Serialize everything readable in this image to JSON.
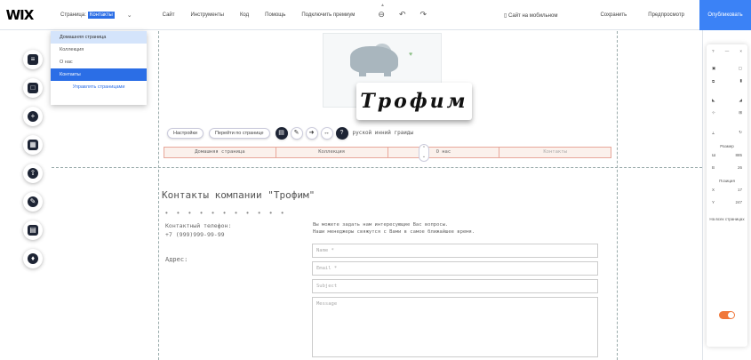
{
  "topbar": {
    "logo": "WIX",
    "pages_label": "Страница:",
    "current_page": "Контакты",
    "menu": [
      "Сайт",
      "Инструменты",
      "Код",
      "Помощь",
      "Подключить премиум"
    ],
    "mobile_label": "Сайт на мобильном",
    "save_label": "Сохранить",
    "preview_label": "Предпросмотр",
    "publish_label": "Опубликовать"
  },
  "pages_dropdown": {
    "items": [
      "Домашняя страница",
      "Коллекция",
      "О нас",
      "Контакты"
    ],
    "manage_link": "Управлять страницами"
  },
  "canvas": {
    "logo_title": "Трофим",
    "context_bar": {
      "settings_label": "Настройки",
      "goto_page_label": "Перейти по странице",
      "suffix_text": "руской инний граиды"
    },
    "nav_items": [
      "Домашняя страница",
      "Коллекция",
      "О нас",
      "Контакты"
    ],
    "contacts_title": "Контакты компании \"Трофим\"",
    "dots": "• • • • • • • • • • •",
    "phone_label": "Контактный телефон:",
    "phone_value": "+7 (999)999-99-99",
    "address_label": "Адрес:",
    "intro_line1": "Вы можете задать нам интересующие Вас вопросы.",
    "intro_line2": "Наши менеджеры свяжутся с Вами в самое ближайшее время.",
    "form": {
      "name_placeholder": "Name *",
      "email_placeholder": "Email *",
      "subject_placeholder": "Subject",
      "message_placeholder": "Message"
    }
  },
  "right_panel": {
    "size_label": "Размер",
    "w_label": "Ш",
    "w_value": "885",
    "h_label": "В",
    "h_value": "26",
    "position_label": "Позиция",
    "x_label": "X",
    "x_value": "17",
    "y_label": "Y",
    "y_value": "247",
    "all_pages_label": "На всех страницах",
    "all_pages_on": true
  },
  "colors": {
    "accent": "#2b6ee6",
    "publish": "#3b82f6",
    "toggle": "#f0773a",
    "nav_border": "#e8a79a"
  }
}
